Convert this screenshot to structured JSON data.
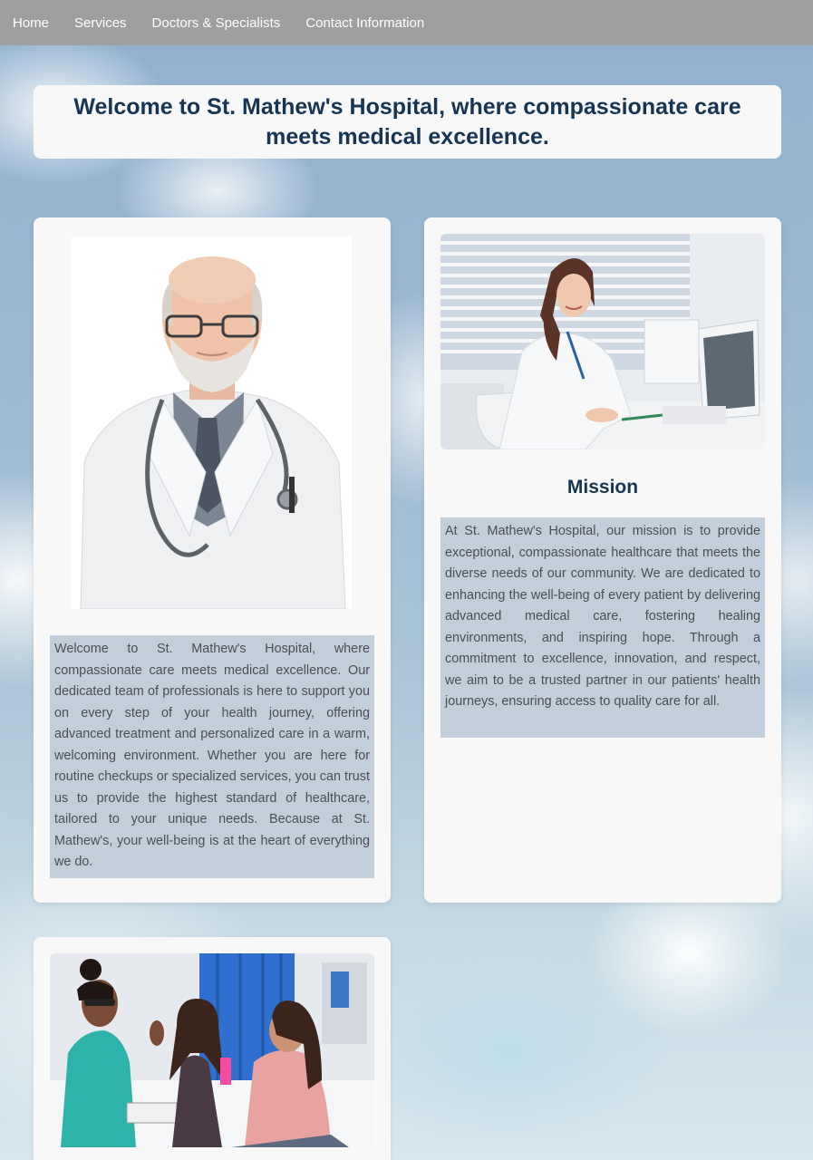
{
  "nav": {
    "items": [
      "Home",
      "Services",
      "Doctors & Specialists",
      "Contact Information"
    ]
  },
  "banner": {
    "title": "Welcome to St. Mathew's Hospital, where compassionate care meets medical excellence."
  },
  "about": {
    "image_icon": "senior-doctor-photo",
    "text": "Welcome to St. Mathew's Hospital, where compassionate care meets medical excellence. Our dedicated team of professionals is here to support you on every step of your health journey, offering advanced treatment and personalized care in a warm, welcoming environment. Whether you are here for routine checkups or specialized services, you can trust us to provide the highest standard of healthcare, tailored to your unique needs. Because at St. Mathew's, your well-being is at the heart of everything we do."
  },
  "mission": {
    "image_icon": "female-doctor-desk-photo",
    "title": "Mission",
    "text": "At St. Mathew's Hospital, our mission is to provide exceptional, compassionate healthcare that meets the diverse needs of our community. We are dedicated to enhancing the well-being of every patient by delivering advanced medical care, fostering healing environments, and inspiring hope. Through a commitment to excellence, innovation, and respect, we aim to be a trusted partner in our patients' health journeys, ensuring access to quality care for all."
  },
  "care": {
    "image_icon": "nurse-with-patient-photo"
  },
  "colors": {
    "nav_bg": "#9d9fa1",
    "title_text": "#173552",
    "card_bg": "#f8f8f9",
    "text_box_bg": "#c3cedb"
  }
}
